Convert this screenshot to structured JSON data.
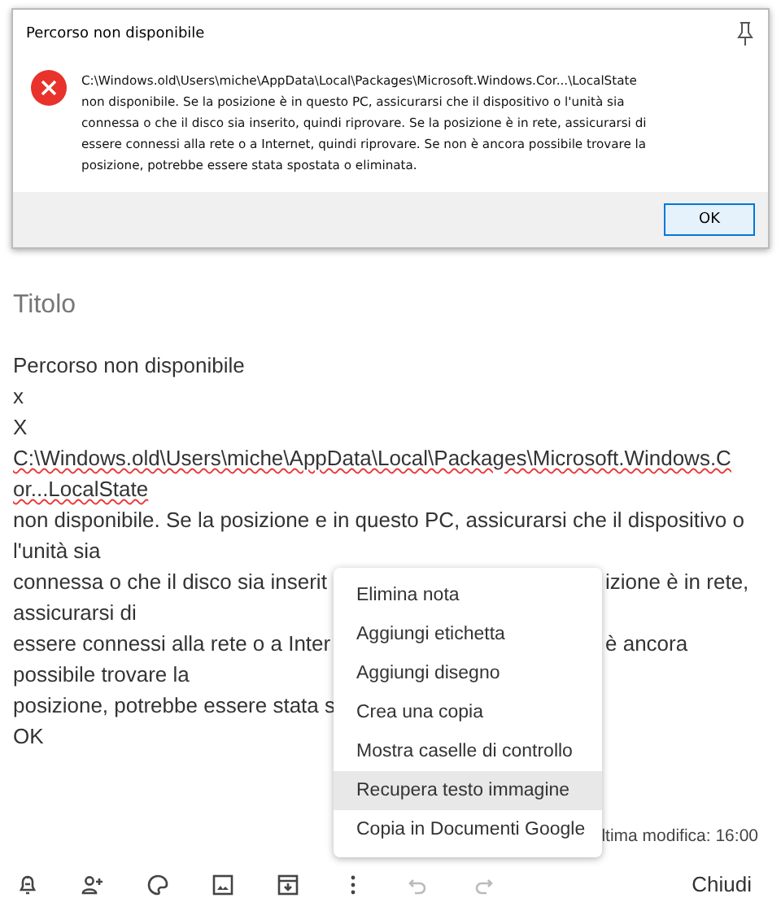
{
  "dialog": {
    "title": "Percorso non disponibile",
    "message_lines": [
      "C:\\Windows.old\\Users\\miche\\AppData\\Local\\Packages\\Microsoft.Windows.Cor...\\LocalState",
      "non disponibile. Se la posizione è in questo PC, assicurarsi che il dispositivo o l'unità sia",
      "connessa o che il disco sia inserito, quindi riprovare. Se la posizione è in rete, assicurarsi di",
      "essere connessi alla rete o a Internet, quindi riprovare. Se non è ancora possibile trovare la",
      "posizione, potrebbe essere stata spostata o eliminata."
    ],
    "button": "OK"
  },
  "note": {
    "title_placeholder": "Titolo",
    "lines": [
      {
        "text": "Percorso non disponibile"
      },
      {
        "text": "x"
      },
      {
        "text": "X"
      },
      {
        "text": "C:\\Windows.old\\Users\\miche\\AppData\\Local\\Packages\\Microsoft.Windows.C",
        "misspelled": true
      },
      {
        "text": "or...LocalState",
        "misspelled": true
      },
      {
        "text": "non disponibile. Se la posizione e in questo PC, assicurarsi che il dispositivo o"
      },
      {
        "text": "l'unità sia"
      },
      {
        "text": "connessa o che il disco sia inserit",
        "tail": "izione è in rete,"
      },
      {
        "text": "assicurarsi di"
      },
      {
        "text": "essere connessi alla rete o a Inter",
        "tail": "è ancora"
      },
      {
        "text": "possibile trovare la"
      },
      {
        "text": "posizione, potrebbe essere stata s"
      },
      {
        "text": "OK"
      }
    ],
    "edited": "ltima modifica: 16:00"
  },
  "menu": [
    {
      "label": "Elimina nota",
      "selected": false
    },
    {
      "label": "Aggiungi etichetta",
      "selected": false
    },
    {
      "label": "Aggiungi disegno",
      "selected": false
    },
    {
      "label": "Crea una copia",
      "selected": false
    },
    {
      "label": "Mostra caselle di controllo",
      "selected": false
    },
    {
      "label": "Recupera testo immagine",
      "selected": true
    },
    {
      "label": "Copia in Documenti Google",
      "selected": false
    }
  ],
  "toolbar": [
    {
      "kind": "reminder",
      "disabled": false
    },
    {
      "kind": "collaborator",
      "disabled": false
    },
    {
      "kind": "palette",
      "disabled": false
    },
    {
      "kind": "image",
      "disabled": false
    },
    {
      "kind": "archive",
      "disabled": false
    },
    {
      "kind": "more",
      "disabled": false
    },
    {
      "kind": "undo",
      "disabled": true
    },
    {
      "kind": "redo",
      "disabled": true
    }
  ],
  "close_button": "Chiudi"
}
